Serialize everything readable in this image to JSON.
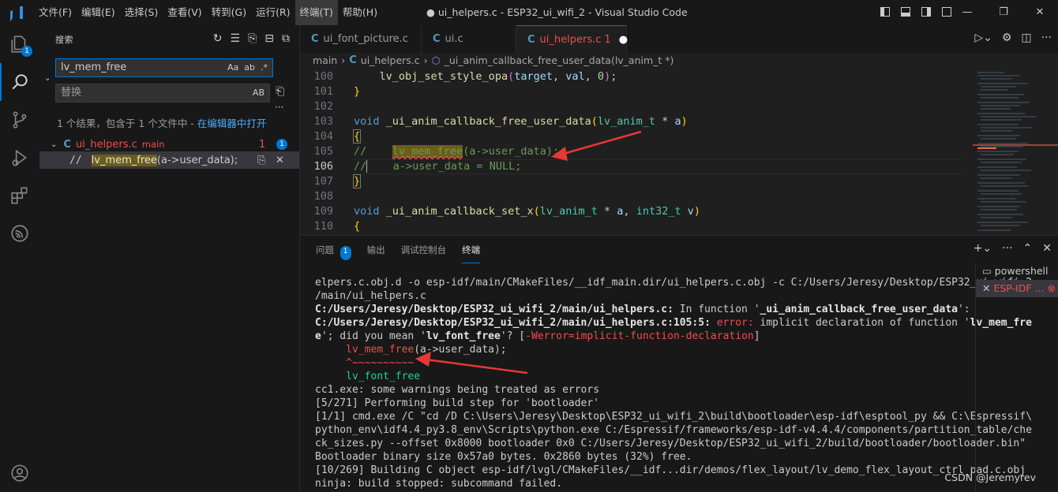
{
  "titlebar": {
    "menus": [
      "文件(F)",
      "编辑(E)",
      "选择(S)",
      "查看(V)",
      "转到(G)",
      "运行(R)",
      "终端(T)",
      "帮助(H)"
    ],
    "window_title": "● ui_helpers.c - ESP32_ui_wifi_2 - Visual Studio Code"
  },
  "activity": {
    "explorer_badge": "1"
  },
  "sidebar": {
    "title": "搜索",
    "search_value": "lv_mem_free",
    "search_opts": [
      "Aa",
      "ab",
      ".*"
    ],
    "replace_placeholder": "替换",
    "replace_opt": "AB",
    "more": "···",
    "summary": "1 个结果，包含于 1 个文件中 - ",
    "summary_link": "在编辑器中打开",
    "file": {
      "name": "ui_helpers.c",
      "folder": "main",
      "count": "1",
      "badge": "1"
    },
    "match": {
      "prefix": "//",
      "highlight": "lv_mem_free",
      "rest": "(a->user_data);"
    }
  },
  "editor": {
    "tabs": [
      {
        "label": "ui_font_picture.c",
        "icon": "C"
      },
      {
        "label": "ui.c",
        "icon": "C"
      },
      {
        "label": "ui_helpers.c",
        "icon": "C",
        "badge": "1",
        "dirty": "●"
      }
    ],
    "breadcrumb": {
      "folder": "main",
      "file": "ui_helpers.c",
      "symbol": "_ui_anim_callback_free_user_data(lv_anim_t *)"
    },
    "line_numbers": [
      "100",
      "101",
      "102",
      "103",
      "104",
      "105",
      "106",
      "107",
      "108",
      "109",
      "110"
    ],
    "code": {
      "l100": {
        "fn": "lv_obj_set_style_opa",
        "args_a": "target",
        "args_b": "val",
        "num": "0"
      },
      "l103": {
        "kw": "void",
        "fn": "_ui_anim_callback_free_user_data",
        "ty": "lv_anim_t",
        "star": " * ",
        "vr": "a"
      },
      "l105": {
        "cm_a": "//    ",
        "cm_hl": "lv_mem_free",
        "cm_b": "(a->user_data);"
      },
      "l106": {
        "cm_a": "//",
        "cm_b": "    a->user_data = NULL;"
      },
      "l109": {
        "kw": "void",
        "fn": "_ui_anim_callback_set_x",
        "ty": "lv_anim_t",
        "star": " * ",
        "vr": "a",
        "ty2": "int32_t",
        "vr2": "v"
      }
    }
  },
  "panel": {
    "tabs": [
      "问题",
      "输出",
      "调试控制台",
      "终端"
    ],
    "problems_badge": "1",
    "terminal_lines": [
      "elpers.c.obj.d -o esp-idf/main/CMakeFiles/__idf_main.dir/ui_helpers.c.obj -c C:/Users/Jeresy/Desktop/ESP32_ui_wifi_2",
      "/main/ui_helpers.c"
    ],
    "err_line1_path": "C:/Users/Jeresy/Desktop/ESP32_ui_wifi_2/main/ui_helpers.c:",
    "err_line1_rest": " In function '",
    "err_line1_func": "_ui_anim_callback_free_user_data",
    "err_line1_end": "':",
    "err_line2_path": "C:/Users/Jeresy/Desktop/ESP32_ui_wifi_2/main/ui_helpers.c:105:5:",
    "err_line2_err": " error:",
    "err_line2_rest": " implicit declaration of function '",
    "err_line2_func": "lv_mem_fre",
    "err_line3_a": "e",
    "err_line3_b": "'; did you mean '",
    "err_line3_func": "lv_font_free",
    "err_line3_c": "'? [",
    "err_line3_flag": "-Werror=implicit-function-declaration",
    "err_line3_d": "]",
    "src_fn": "lv_mem_free",
    "src_rest": "(a->user_data);",
    "caret": "^~~~~~~~~~~",
    "suggest": "lv_font_free",
    "tail_lines": [
      "cc1.exe: some warnings being treated as errors",
      "[5/271] Performing build step for 'bootloader'",
      "[1/1] cmd.exe /C \"cd /D C:\\Users\\Jeresy\\Desktop\\ESP32_ui_wifi_2\\build\\bootloader\\esp-idf\\esptool_py && C:\\Espressif\\",
      "python_env\\idf4.4_py3.8_env\\Scripts\\python.exe C:/Espressif/frameworks/esp-idf-v4.4.4/components/partition_table/che",
      "ck_sizes.py --offset 0x8000 bootloader 0x0 C:/Users/Jeresy/Desktop/ESP32_ui_wifi_2/build/bootloader/bootloader.bin\"",
      "Bootloader binary size 0x57a0 bytes. 0x2860 bytes (32%) free.",
      "[10/269] Building C object esp-idf/lvgl/CMakeFiles/__idf...dir/demos/flex_layout/lv_demo_flex_layout_ctrl_pad.c.obj",
      "ninja: build stopped: subcommand failed."
    ],
    "terminals": [
      "powershell",
      "ESP-IDF ..."
    ]
  },
  "watermark": "CSDN @Jeremyrev",
  "colors": {
    "accent": "#0078d4",
    "error": "#f14c4c",
    "arrow": "#e53935"
  }
}
